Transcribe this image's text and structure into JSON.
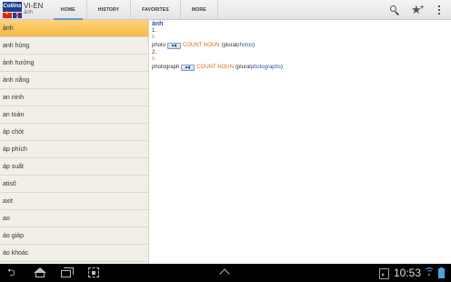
{
  "app": {
    "logo_text": "Collins",
    "title": "VI-EN",
    "subtitle": "ảnh"
  },
  "tabs": [
    {
      "label": "HOME",
      "active": true
    },
    {
      "label": "HISTORY",
      "active": false
    },
    {
      "label": "FAVORITES",
      "active": false
    },
    {
      "label": "MORE",
      "active": false
    }
  ],
  "actions": {
    "search": "search-icon",
    "favorite_add": "star-plus-icon",
    "overflow": "overflow-menu-icon"
  },
  "word_list": {
    "selected_index": 0,
    "items": [
      "ảnh",
      "anh hùng",
      "ảnh hưởng",
      "ánh nắng",
      "an ninh",
      "an toàn",
      "áp chót",
      "áp phích",
      "áp suất",
      "atisô",
      "axit",
      "ao",
      "áo giáp",
      "áo khoác"
    ]
  },
  "entry": {
    "headword": "ảnh",
    "senses": [
      {
        "number": "1.",
        "pos": "n",
        "translation": "photo",
        "label": "COUNT NOUN",
        "plural_prefix": "(plural ",
        "plural": "photos",
        "plural_suffix": ")"
      },
      {
        "number": "2.",
        "pos": "n",
        "translation": "photograph",
        "label": "COUNT NOUN",
        "plural_prefix": "(plural ",
        "plural": "photographs",
        "plural_suffix": ")"
      }
    ]
  },
  "status_bar": {
    "time": "10:53"
  },
  "colors": {
    "selected_item": "#f7b843",
    "headword": "#2c5aa0",
    "part_of_speech": "#e06b1c",
    "list_background": "#f1efe8"
  }
}
